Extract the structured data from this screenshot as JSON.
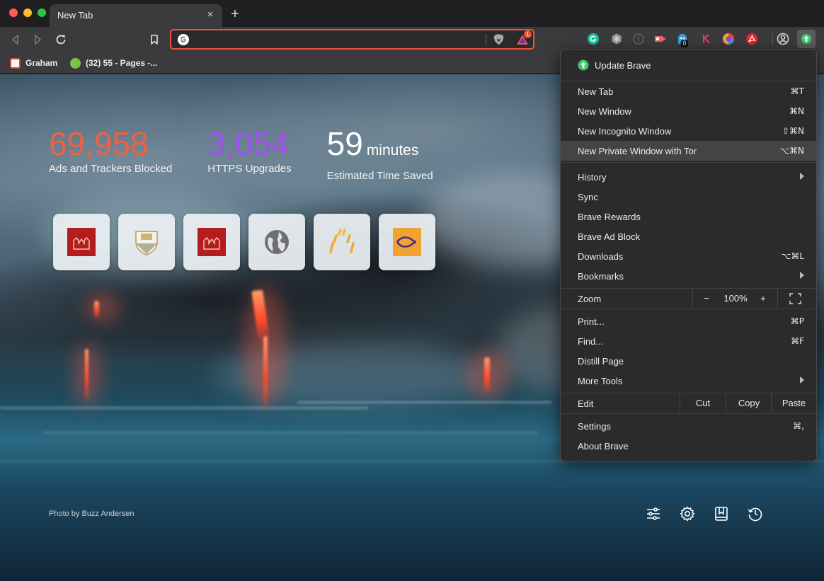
{
  "tab": {
    "title": "New Tab",
    "close": "×",
    "new_tab": "+"
  },
  "omnibox": {
    "value": "",
    "rewards_badge": "1"
  },
  "extensions": {
    "ublock_count": "0"
  },
  "bookmarks": [
    {
      "label": "Graham"
    },
    {
      "label": "(32) 55 - Pages -..."
    }
  ],
  "stats": {
    "ads_blocked": "69,958",
    "ads_label": "Ads and Trackers Blocked",
    "https_upgrades": "3,054",
    "https_label": "HTTPS Upgrades",
    "time_saved": "59",
    "time_unit": "minutes",
    "time_label": "Estimated Time Saved"
  },
  "photo_credit": "Photo by Buzz Andersen",
  "colors": {
    "ads": "#ef6145",
    "https": "#a44ff0",
    "omnibox_border": "#e8553a",
    "menu_bg": "#2b2b2e"
  },
  "menu": {
    "update": "Update Brave",
    "new_tab": {
      "label": "New Tab",
      "shortcut": "⌘T"
    },
    "new_window": {
      "label": "New Window",
      "shortcut": "⌘N"
    },
    "new_incognito": {
      "label": "New Incognito Window",
      "shortcut": "⇧⌘N"
    },
    "new_tor": {
      "label": "New Private Window with Tor",
      "shortcut": "⌥⌘N"
    },
    "history": {
      "label": "History"
    },
    "sync": {
      "label": "Sync"
    },
    "rewards": {
      "label": "Brave Rewards"
    },
    "adblock": {
      "label": "Brave Ad Block"
    },
    "downloads": {
      "label": "Downloads",
      "shortcut": "⌥⌘L"
    },
    "bookmarks": {
      "label": "Bookmarks"
    },
    "zoom": {
      "label": "Zoom",
      "minus": "−",
      "value": "100%",
      "plus": "+"
    },
    "print": {
      "label": "Print...",
      "shortcut": "⌘P"
    },
    "find": {
      "label": "Find...",
      "shortcut": "⌘F"
    },
    "distill": {
      "label": "Distill Page"
    },
    "more_tools": {
      "label": "More Tools"
    },
    "edit": {
      "label": "Edit",
      "cut": "Cut",
      "copy": "Copy",
      "paste": "Paste"
    },
    "settings": {
      "label": "Settings",
      "shortcut": "⌘,"
    },
    "about": {
      "label": "About Brave"
    }
  }
}
